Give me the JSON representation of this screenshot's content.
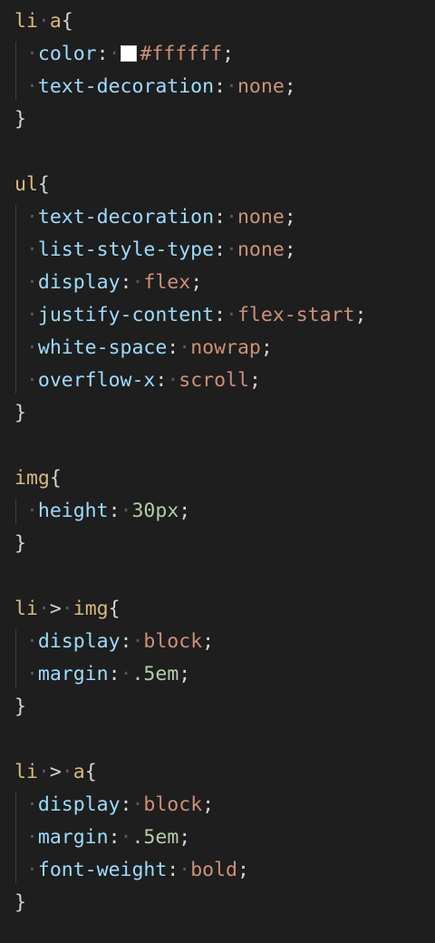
{
  "colors": {
    "background": "#1e1e1e",
    "selector": "#d7ba7d",
    "property": "#9cdcfe",
    "string_value": "#ce9178",
    "number_value": "#b5cea8",
    "punctuation": "#d4d4d4",
    "swatch": "#ffffff"
  },
  "rules": [
    {
      "selector": "li a",
      "declarations": [
        {
          "property": "color",
          "value": "#ffffff",
          "kind": "color"
        },
        {
          "property": "text-decoration",
          "value": "none",
          "kind": "keyword"
        }
      ]
    },
    {
      "selector": "ul",
      "declarations": [
        {
          "property": "text-decoration",
          "value": "none",
          "kind": "keyword"
        },
        {
          "property": "list-style-type",
          "value": "none",
          "kind": "keyword"
        },
        {
          "property": "display",
          "value": "flex",
          "kind": "keyword"
        },
        {
          "property": "justify-content",
          "value": "flex-start",
          "kind": "keyword"
        },
        {
          "property": "white-space",
          "value": "nowrap",
          "kind": "keyword"
        },
        {
          "property": "overflow-x",
          "value": "scroll",
          "kind": "keyword"
        }
      ]
    },
    {
      "selector": "img",
      "declarations": [
        {
          "property": "height",
          "value": "30px",
          "kind": "number"
        }
      ]
    },
    {
      "selector": "li > img",
      "declarations": [
        {
          "property": "display",
          "value": "block",
          "kind": "keyword"
        },
        {
          "property": "margin",
          "value": ".5em",
          "kind": "number"
        }
      ]
    },
    {
      "selector": "li > a",
      "declarations": [
        {
          "property": "display",
          "value": "block",
          "kind": "keyword"
        },
        {
          "property": "margin",
          "value": ".5em",
          "kind": "number"
        },
        {
          "property": "font-weight",
          "value": "bold",
          "kind": "keyword"
        }
      ]
    }
  ]
}
